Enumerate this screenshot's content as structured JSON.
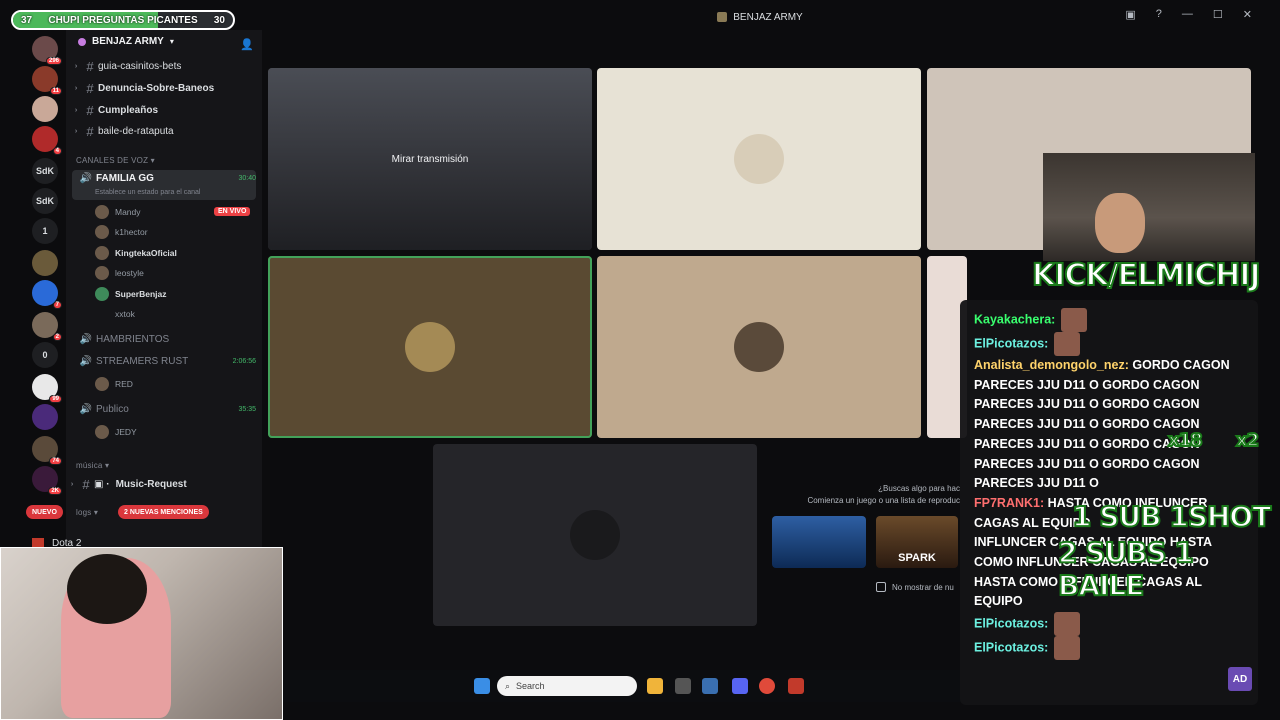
{
  "progress": {
    "left": "37",
    "label": "CHUPI PREGUNTAS PICANTES",
    "right": "30",
    "fraction": 0.66
  },
  "window": {
    "title": "BENJAZ ARMY",
    "min": "—",
    "max": "☐",
    "close": "✕",
    "help": "?"
  },
  "rail": [
    {
      "badge": "296"
    },
    {
      "badge": "11"
    },
    {
      "badge": ""
    },
    {
      "badge": "4"
    },
    {
      "label": "SdK"
    },
    {
      "label": "SdK"
    },
    {
      "label": "1"
    },
    {
      "badge": ""
    },
    {
      "badge": "7"
    },
    {
      "badge": "2"
    },
    {
      "label": "0"
    },
    {
      "badge": "99"
    },
    {
      "badge": ""
    },
    {
      "badge": "74"
    },
    {
      "badge": "2K"
    }
  ],
  "server": {
    "name": "BENJAZ ARMY"
  },
  "channels": [
    "guia-casinitos-bets",
    "Denuncia-Sobre-Baneos",
    "Cumpleaños",
    "baile-de-rataputa"
  ],
  "voice_category": "CANALES DE VOZ",
  "voice_active": {
    "name": "FAMILIA GG",
    "time": "30:40",
    "status": "Establece un estado para el canal"
  },
  "members": [
    {
      "name": "Mandy"
    },
    {
      "name": "k1hector"
    },
    {
      "name": "KingtekaOficial"
    },
    {
      "name": "leostyle"
    },
    {
      "name": "SuperBenjaz"
    },
    {
      "name": "xxtok"
    }
  ],
  "live_label": "EN VIVO",
  "voice_others": [
    {
      "name": "HAMBRIENTOS",
      "time": ""
    },
    {
      "name": "STREAMERS RUST",
      "time": "2:06:56"
    },
    {
      "name": "Publico",
      "time": "35:35"
    }
  ],
  "sub_members": {
    "rust": "RED",
    "publico": "JEDY"
  },
  "music_category": "música",
  "music_channel": "Music-Request",
  "logs_category": "logs",
  "new_pill": "NUEVO",
  "mentions_pill": "2 NUEVAS MENCIONES",
  "dota": "Dota 2",
  "grid": {
    "watch": "Mirar transmisión"
  },
  "prompt": {
    "line1": "¿Buscas algo para hac",
    "line2": "Comienza un juego o una lista de reproduc",
    "thumb_label": "SPARK",
    "nomostrar": "No mostrar de nu"
  },
  "taskbar": {
    "search": "Search"
  },
  "overlay": {
    "kick": "KICK/ELMICHIJ",
    "sub1": "1 SUB  1SHOT",
    "sub2": "2 SUBS 1 BAILE",
    "mult1": "x18",
    "mult2": "x2"
  },
  "chat": [
    {
      "user": "Kayakachera",
      "color": "green",
      "text": ""
    },
    {
      "user": "ElPicotazos",
      "color": "cyan",
      "text": ""
    },
    {
      "user": "Analista_demongolo_nez",
      "color": "yellow",
      "text": "GORDO CAGON"
    },
    {
      "user": "",
      "color": "",
      "text": "PARECES JJU D11 O   GORDO CAGON"
    },
    {
      "user": "",
      "color": "",
      "text": "PARECES JJU D11 O   GORDO CAGON"
    },
    {
      "user": "",
      "color": "",
      "text": "PARECES JJU D11 O   GORDO CAGON"
    },
    {
      "user": "",
      "color": "",
      "text": "PARECES JJU D11 O   GORDO CAGON"
    },
    {
      "user": "",
      "color": "",
      "text": "PARECES JJU D11 O   GORDO CAGON"
    },
    {
      "user": "",
      "color": "",
      "text": "PARECES JJU D11 O"
    },
    {
      "user": "FP7RANK1",
      "color": "red",
      "text": "HASTA COMO INFLUNCER"
    },
    {
      "user": "",
      "color": "",
      "text": "CAGAS AL EQUIPO"
    },
    {
      "user": "",
      "color": "",
      "text": "INFLUNCER CAGAS AL EQUIPO   HASTA"
    },
    {
      "user": "",
      "color": "",
      "text": "COMO INFLUNCER CAGAS AL EQUIPO"
    },
    {
      "user": "",
      "color": "",
      "text": "HASTA COMO INFLUNCER CAGAS AL"
    },
    {
      "user": "",
      "color": "",
      "text": "EQUIPO"
    },
    {
      "user": "ElPicotazos",
      "color": "cyan",
      "text": ""
    },
    {
      "user": "ElPicotazos",
      "color": "cyan",
      "text": ""
    }
  ],
  "chat_logo": "AD",
  "brand_colors": {
    "discord_green": "#43a25a",
    "kick_green": "#53fc18",
    "mention_red": "#da373c"
  }
}
